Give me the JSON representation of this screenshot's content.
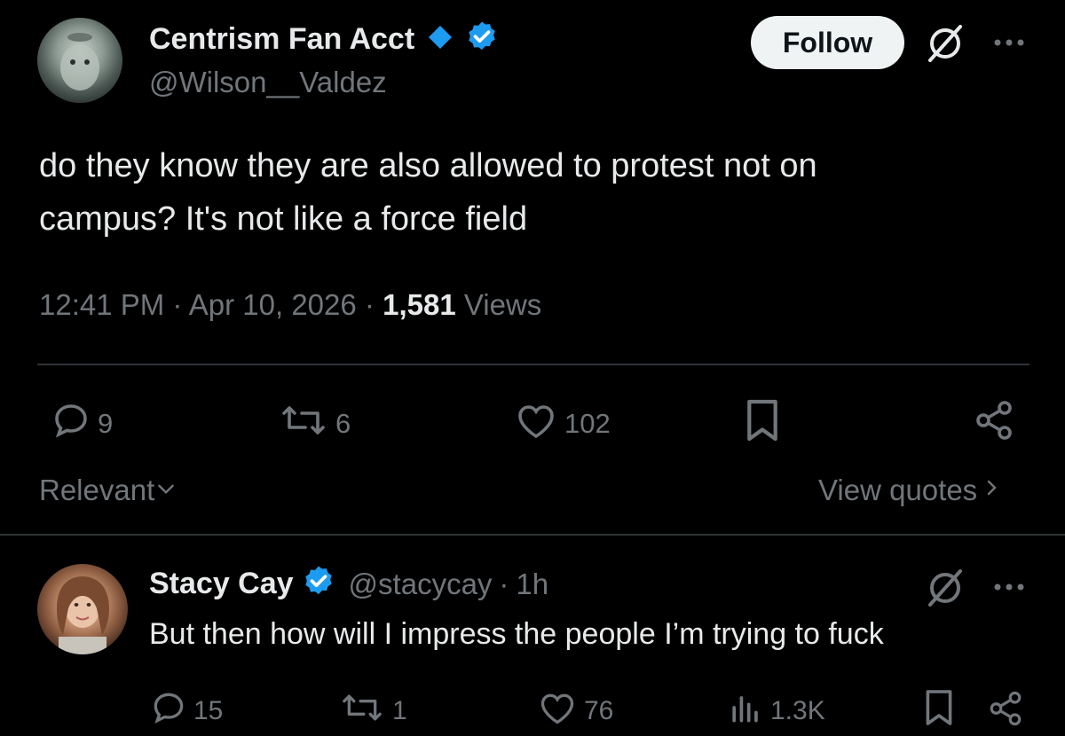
{
  "tweet": {
    "author_name": "Centrism Fan Acct",
    "author_handle": "@Wilson__Valdez",
    "follow_label": "Follow",
    "text_line1": "do they know they are also allowed to protest not on",
    "text_line2": "campus? It's not like a force field",
    "time": "12:41 PM",
    "date": "Apr 10, 2026",
    "views_count": "1,581",
    "views_label": "Views",
    "replies": "9",
    "reposts": "6",
    "likes": "102"
  },
  "sort": {
    "label": "Relevant",
    "view_quotes": "View quotes"
  },
  "reply": {
    "author_name": "Stacy Cay",
    "author_handle": "@stacycay",
    "time": "1h",
    "text": "But then how will I impress the people I’m trying to fuck",
    "replies": "15",
    "reposts": "1",
    "likes": "76",
    "views": "1.3K"
  },
  "colors": {
    "verified_blue": "#1d9bf0",
    "background": "#000000",
    "muted": "#71767b"
  },
  "icons": [
    "grok-icon",
    "more-icon",
    "reply-icon",
    "repost-icon",
    "like-icon",
    "bookmark-icon",
    "share-icon",
    "views-icon",
    "verified-badge-icon",
    "diamond-icon",
    "chevron-down-icon",
    "chevron-right-icon"
  ]
}
